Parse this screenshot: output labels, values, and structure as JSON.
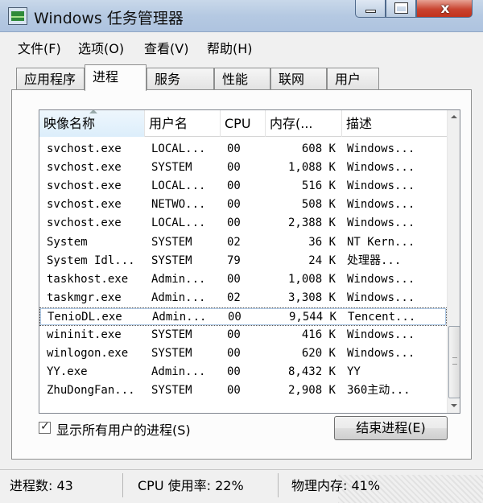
{
  "window": {
    "title": "Windows 任务管理器",
    "close_glyph": "x",
    "icons": [
      "task-manager-icon",
      "minimize-icon",
      "maximize-icon",
      "close-icon"
    ]
  },
  "menu": [
    "文件(F)",
    "选项(O)",
    "查看(V)",
    "帮助(H)"
  ],
  "tabs": [
    "应用程序",
    "进程",
    "服务",
    "性能",
    "联网",
    "用户"
  ],
  "active_tab": "进程",
  "columns": {
    "name": "映像名称",
    "user": "用户名",
    "cpu": "CPU",
    "mem": "内存(...",
    "desc": "描述"
  },
  "processes": [
    {
      "name": "svchost.exe",
      "user": "LOCAL...",
      "cpu": "00",
      "mem": "608 K",
      "desc": "Windows..."
    },
    {
      "name": "svchost.exe",
      "user": "SYSTEM",
      "cpu": "00",
      "mem": "1,088 K",
      "desc": "Windows..."
    },
    {
      "name": "svchost.exe",
      "user": "LOCAL...",
      "cpu": "00",
      "mem": "516 K",
      "desc": "Windows..."
    },
    {
      "name": "svchost.exe",
      "user": "NETWO...",
      "cpu": "00",
      "mem": "508 K",
      "desc": "Windows..."
    },
    {
      "name": "svchost.exe",
      "user": "LOCAL...",
      "cpu": "00",
      "mem": "2,388 K",
      "desc": "Windows..."
    },
    {
      "name": "System",
      "user": "SYSTEM",
      "cpu": "02",
      "mem": "36 K",
      "desc": "NT Kern..."
    },
    {
      "name": "System Idl...",
      "user": "SYSTEM",
      "cpu": "79",
      "mem": "24 K",
      "desc": "处理器..."
    },
    {
      "name": "taskhost.exe",
      "user": "Admin...",
      "cpu": "00",
      "mem": "1,008 K",
      "desc": "Windows..."
    },
    {
      "name": "taskmgr.exe",
      "user": "Admin...",
      "cpu": "02",
      "mem": "3,308 K",
      "desc": "Windows..."
    },
    {
      "name": "TenioDL.exe",
      "user": "Admin...",
      "cpu": "00",
      "mem": "9,544 K",
      "desc": "Tencent..."
    },
    {
      "name": "wininit.exe",
      "user": "SYSTEM",
      "cpu": "00",
      "mem": "416 K",
      "desc": "Windows..."
    },
    {
      "name": "winlogon.exe",
      "user": "SYSTEM",
      "cpu": "00",
      "mem": "620 K",
      "desc": "Windows..."
    },
    {
      "name": "YY.exe",
      "user": "Admin...",
      "cpu": "00",
      "mem": "8,432 K",
      "desc": "YY"
    },
    {
      "name": "ZhuDongFan...",
      "user": "SYSTEM",
      "cpu": "00",
      "mem": "2,908 K",
      "desc": "360主动..."
    }
  ],
  "selected_process": "TenioDL.exe",
  "show_all_users": {
    "label": "显示所有用户的进程(S)",
    "checked": true
  },
  "end_process_button": "结束进程(E)",
  "status": {
    "process_count": "进程数: 43",
    "cpu_usage": "CPU 使用率: 22%",
    "memory": "物理内存: 41%"
  }
}
